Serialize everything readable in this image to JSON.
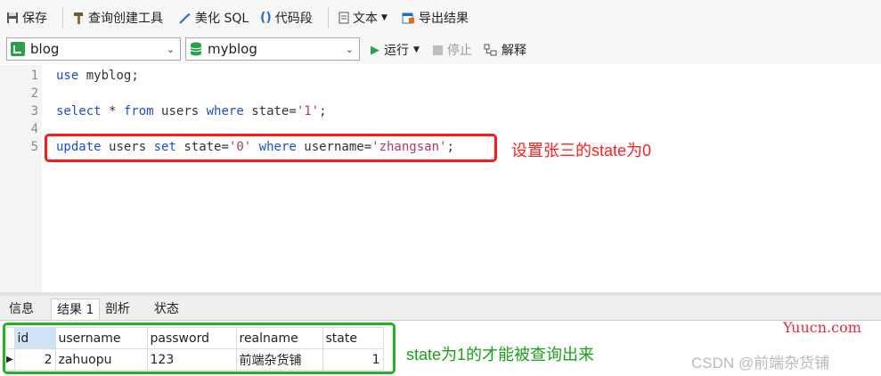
{
  "toolbar": {
    "save": "保存",
    "query_builder": "查询创建工具",
    "beautify_sql": "美化 SQL",
    "code_snippet": "代码段",
    "text": "文本",
    "export_results": "导出结果"
  },
  "connection": {
    "connection_value": "blog",
    "database_value": "myblog",
    "run": "运行",
    "stop": "停止",
    "explain": "解释"
  },
  "editor": {
    "line_numbers": [
      "1",
      "2",
      "3",
      "4",
      "5"
    ],
    "line1": "use myblog;",
    "line3": "select * from users where state='1';",
    "line5": "update users set state='0' where username='zhangsan';"
  },
  "annotations": {
    "red_note": "设置张三的state为0",
    "green_note": "state为1的才能被查询出来"
  },
  "result_tabs": [
    "信息",
    "结果 1",
    "剖析",
    "状态"
  ],
  "result_grid": {
    "columns": [
      "id",
      "username",
      "password",
      "realname",
      "state"
    ],
    "rows": [
      [
        "2",
        "zahuopu",
        "123",
        "前端杂货铺",
        "1"
      ]
    ]
  },
  "watermarks": {
    "yuucn": "Yuucn.com",
    "csdn": "CSDN @前端杂货铺"
  },
  "colors": {
    "keyword": "#1a4fd6",
    "string": "#b8336a",
    "annotation_red": "#ff1a1a",
    "annotation_green": "#22b322"
  }
}
